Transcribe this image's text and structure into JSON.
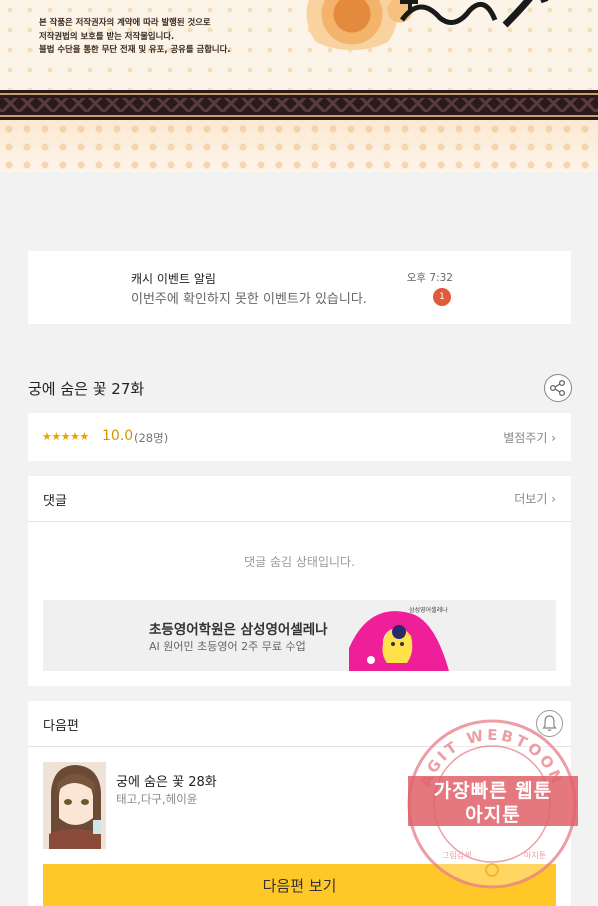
{
  "banner": {
    "notice_lines": [
      "본 작품은 저작권자의 계약에 따라 발행된 것으로",
      "저작권법의 보호를 받는 저작물입니다.",
      "불법 수단을 통한 무단 전재 및 유포, 공유를 금합니다."
    ]
  },
  "notification": {
    "title": "캐시 이벤트 알림",
    "message": "이번주에 확인하지 못한 이벤트가 있습니다.",
    "time": "오후 7:32",
    "badge": "1"
  },
  "episode": {
    "title": "궁에 숨은 꽃 27화",
    "share_icon": "share-icon"
  },
  "rating": {
    "stars": "★★★★★",
    "score": "10.0",
    "count": "(28명)",
    "rate_link": "별점주기 ›"
  },
  "comments": {
    "header": "댓글",
    "more_link": "더보기 ›",
    "hidden_message": "댓글 숨김 상태입니다."
  },
  "ad": {
    "title": "초등영어학원은 삼성영어셀레나",
    "subtitle": "AI 원어민 초등영어 2주 무료 수업",
    "tiny": "삼성영어셀레나"
  },
  "next_episode": {
    "header": "다음편",
    "title": "궁에 숨은 꽃 28화",
    "authors": "태고,다구,헤이윤",
    "button": "다음편 보기"
  },
  "watermark": {
    "ring_text": "AGIT WEBTOON",
    "line1": "가장빠른 웹툰",
    "line2": "아지툰",
    "small_left": "그림검색",
    "small_right": "아지툰"
  },
  "colors": {
    "button_yellow": "#ffc727",
    "badge_red": "#e15a3a",
    "star_gold": "#e8a100",
    "watermark_pink": "#e15f69"
  }
}
